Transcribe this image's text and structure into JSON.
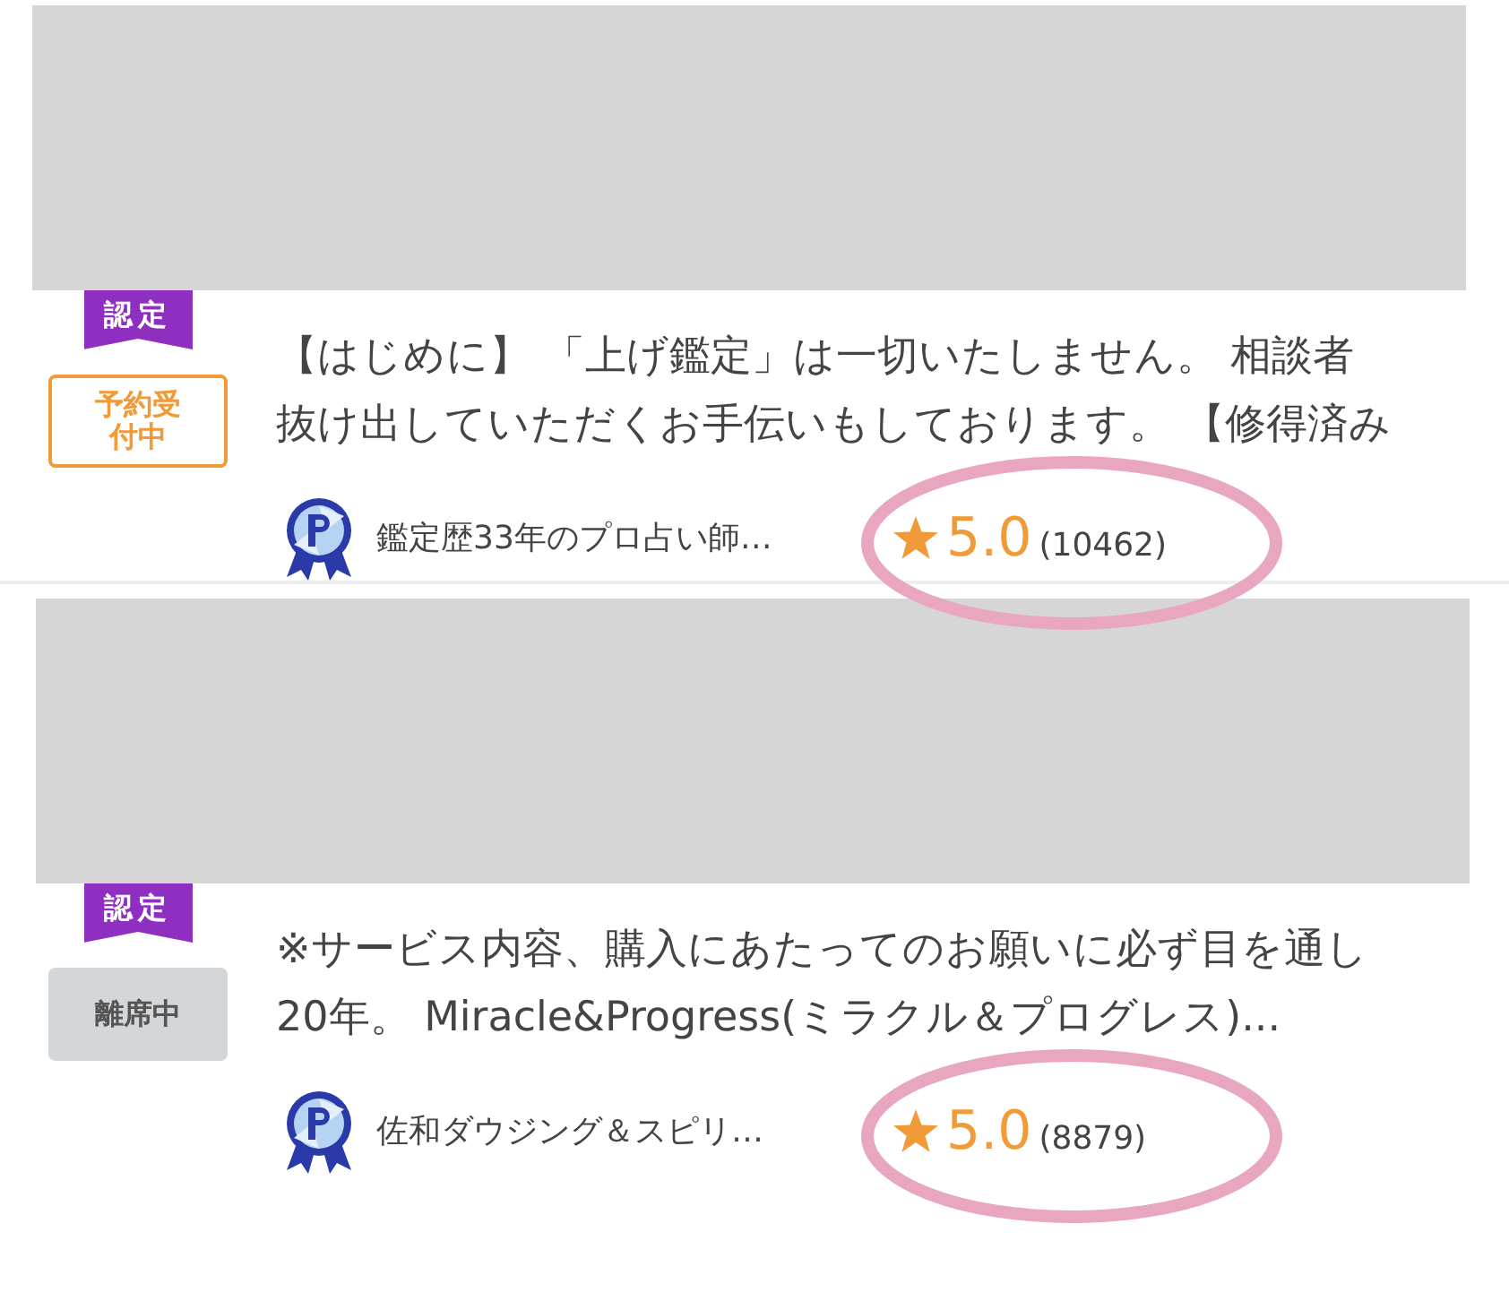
{
  "cards": [
    {
      "certified_label": "認定",
      "status": {
        "kind": "reservable",
        "label": "予約受付中"
      },
      "description_lines": [
        "【はじめに】 「上げ鑑定」は一切いたしません。 相談者",
        "抜け出していただくお手伝いもしております。 【修得済み"
      ],
      "author": "鑑定歴33年のプロ占い師…",
      "rating": "5.0",
      "review_count": "(10462)",
      "highlighted": true
    },
    {
      "certified_label": "認定",
      "status": {
        "kind": "away",
        "label": "離席中"
      },
      "description_lines": [
        "※サービス内容、購入にあたってのお願いに必ず目を通し",
        "20年。 Miracle&Progress(ミラクル＆プログレス)..."
      ],
      "author": "佐和ダウジング＆スピリ…",
      "rating": "5.0",
      "review_count": "(8879)",
      "highlighted": true
    }
  ]
}
